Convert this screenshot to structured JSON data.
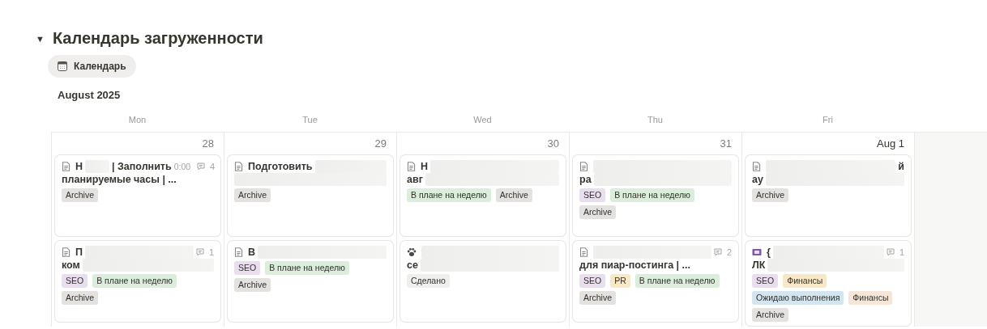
{
  "section": {
    "toggle": "▼",
    "expanded": true,
    "title": "Календарь загруженности"
  },
  "view_tab": {
    "label": "Календарь"
  },
  "month": "August 2025",
  "weekdays": [
    "Mon",
    "Tue",
    "Wed",
    "Thu",
    "Fri"
  ],
  "days": [
    {
      "date": "28",
      "cards": [
        {
          "kind": "page",
          "lines": [
            [
              {
                "kind": "text",
                "text": "Н"
              },
              {
                "kind": "redacted"
              },
              {
                "kind": "text",
                "text": "| Заполнить"
              }
            ],
            [
              {
                "kind": "text",
                "text": "планируемые часы | ..."
              }
            ]
          ],
          "time": "0:00",
          "comments": "4",
          "tags": [
            {
              "label": "Archive",
              "color": "#e3e2e0"
            }
          ]
        },
        {
          "kind": "page",
          "lines": [
            [
              {
                "kind": "text",
                "text": "П"
              },
              {
                "kind": "redacted"
              }
            ],
            [
              {
                "kind": "text",
                "text": "ком"
              },
              {
                "kind": "redacted"
              }
            ]
          ],
          "comments": "1",
          "tags": [
            {
              "label": "SEO",
              "color": "#e8deee"
            },
            {
              "label": "В плане на неделю",
              "color": "#dbeddb"
            },
            {
              "label": "Archive",
              "color": "#e3e2e0"
            }
          ]
        }
      ]
    },
    {
      "date": "29",
      "cards": [
        {
          "kind": "page",
          "lines": [
            [
              {
                "kind": "text",
                "text": "Подготовить"
              },
              {
                "kind": "redacted"
              }
            ],
            [
              {
                "kind": "redacted"
              }
            ]
          ],
          "tags": [
            {
              "label": "Archive",
              "color": "#e3e2e0"
            }
          ]
        },
        {
          "kind": "page",
          "lines": [
            [
              {
                "kind": "text",
                "text": "В"
              },
              {
                "kind": "redacted"
              }
            ]
          ],
          "tags": [
            {
              "label": "SEO",
              "color": "#e8deee"
            },
            {
              "label": "В плане на неделю",
              "color": "#dbeddb"
            },
            {
              "label": "Archive",
              "color": "#e3e2e0"
            }
          ]
        }
      ]
    },
    {
      "date": "30",
      "cards": [
        {
          "kind": "page",
          "lines": [
            [
              {
                "kind": "text",
                "text": "Н"
              },
              {
                "kind": "redacted"
              }
            ],
            [
              {
                "kind": "text",
                "text": "авг"
              },
              {
                "kind": "redacted"
              }
            ]
          ],
          "tags": [
            {
              "label": "В плане на неделю",
              "color": "#dbeddb"
            },
            {
              "label": "Archive",
              "color": "#e3e2e0"
            }
          ]
        },
        {
          "kind": "paw",
          "lines": [
            [
              {
                "kind": "redacted"
              }
            ],
            [
              {
                "kind": "text",
                "text": "се"
              },
              {
                "kind": "redacted"
              }
            ]
          ],
          "tags": [
            {
              "label": "Сделано",
              "color": "#efefed"
            }
          ]
        }
      ]
    },
    {
      "date": "31",
      "cards": [
        {
          "kind": "page",
          "lines": [
            [
              {
                "kind": "redacted"
              }
            ],
            [
              {
                "kind": "text",
                "text": "ра"
              },
              {
                "kind": "redacted"
              }
            ]
          ],
          "tags": [
            {
              "label": "SEO",
              "color": "#e8deee"
            },
            {
              "label": "В плане на неделю",
              "color": "#dbeddb"
            },
            {
              "label": "Archive",
              "color": "#e3e2e0"
            }
          ]
        },
        {
          "kind": "page",
          "lines": [
            [
              {
                "kind": "redacted"
              }
            ],
            [
              {
                "kind": "text",
                "text": "для пиар-постинга | ..."
              }
            ]
          ],
          "comments": "2",
          "tags": [
            {
              "label": "SEO",
              "color": "#e8deee"
            },
            {
              "label": "PR",
              "color": "#f9e8c5"
            },
            {
              "label": "В плане на неделю",
              "color": "#dbeddb"
            },
            {
              "label": "Archive",
              "color": "#e3e2e0"
            }
          ]
        }
      ]
    },
    {
      "date": "Aug 1",
      "today": true,
      "cards": [
        {
          "kind": "page",
          "lines": [
            [
              {
                "kind": "redacted"
              },
              {
                "kind": "text",
                "text": "й"
              }
            ],
            [
              {
                "kind": "text",
                "text": "ау"
              },
              {
                "kind": "redacted"
              }
            ]
          ],
          "tags": [
            {
              "label": "Archive",
              "color": "#e3e2e0"
            }
          ]
        },
        {
          "kind": "ticket",
          "lines": [
            [
              {
                "kind": "text",
                "text": "{"
              },
              {
                "kind": "redacted"
              }
            ],
            [
              {
                "kind": "text",
                "text": "ЛК"
              },
              {
                "kind": "redacted"
              }
            ]
          ],
          "comments": "1",
          "tags": [
            {
              "label": "SEO",
              "color": "#e8deee"
            },
            {
              "label": "Финансы",
              "color": "#f9e8c5"
            },
            {
              "label": "Ожидаю выполнения",
              "color": "#d3e5ef"
            },
            {
              "label": "Финансы",
              "color": "#f5e6d8"
            },
            {
              "label": "Archive",
              "color": "#e3e2e0"
            }
          ]
        }
      ]
    }
  ]
}
